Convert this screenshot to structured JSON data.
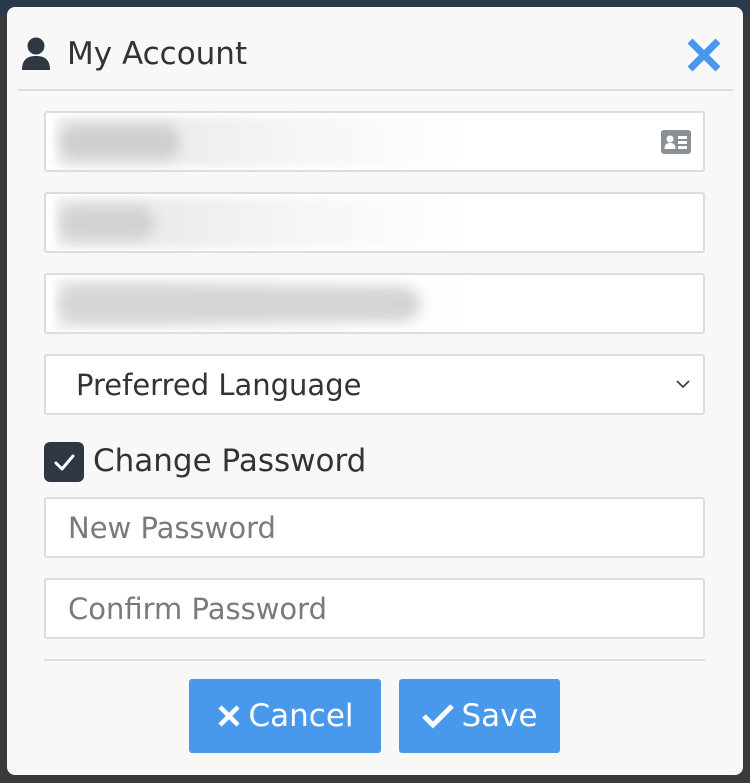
{
  "dialog": {
    "title": "My Account",
    "icon": "user-icon",
    "close_icon": "close-icon",
    "accent_color": "#4899ec",
    "header_icon_color": "#2f3742"
  },
  "form": {
    "first_name": {
      "value": "",
      "blurred": true,
      "icon": "id-card-icon"
    },
    "last_name": {
      "value": "",
      "blurred": true
    },
    "email": {
      "value": "",
      "blurred": true
    },
    "language_select": {
      "selected": "Preferred Language",
      "icon": "chevron-down-icon"
    },
    "change_password": {
      "label": "Change Password",
      "checked": true
    },
    "new_password": {
      "placeholder": "New Password",
      "value": ""
    },
    "confirm_password": {
      "placeholder": "Confirm Password",
      "value": ""
    }
  },
  "footer": {
    "cancel_label": "Cancel",
    "cancel_icon": "times-icon",
    "save_label": "Save",
    "save_icon": "check-icon"
  }
}
